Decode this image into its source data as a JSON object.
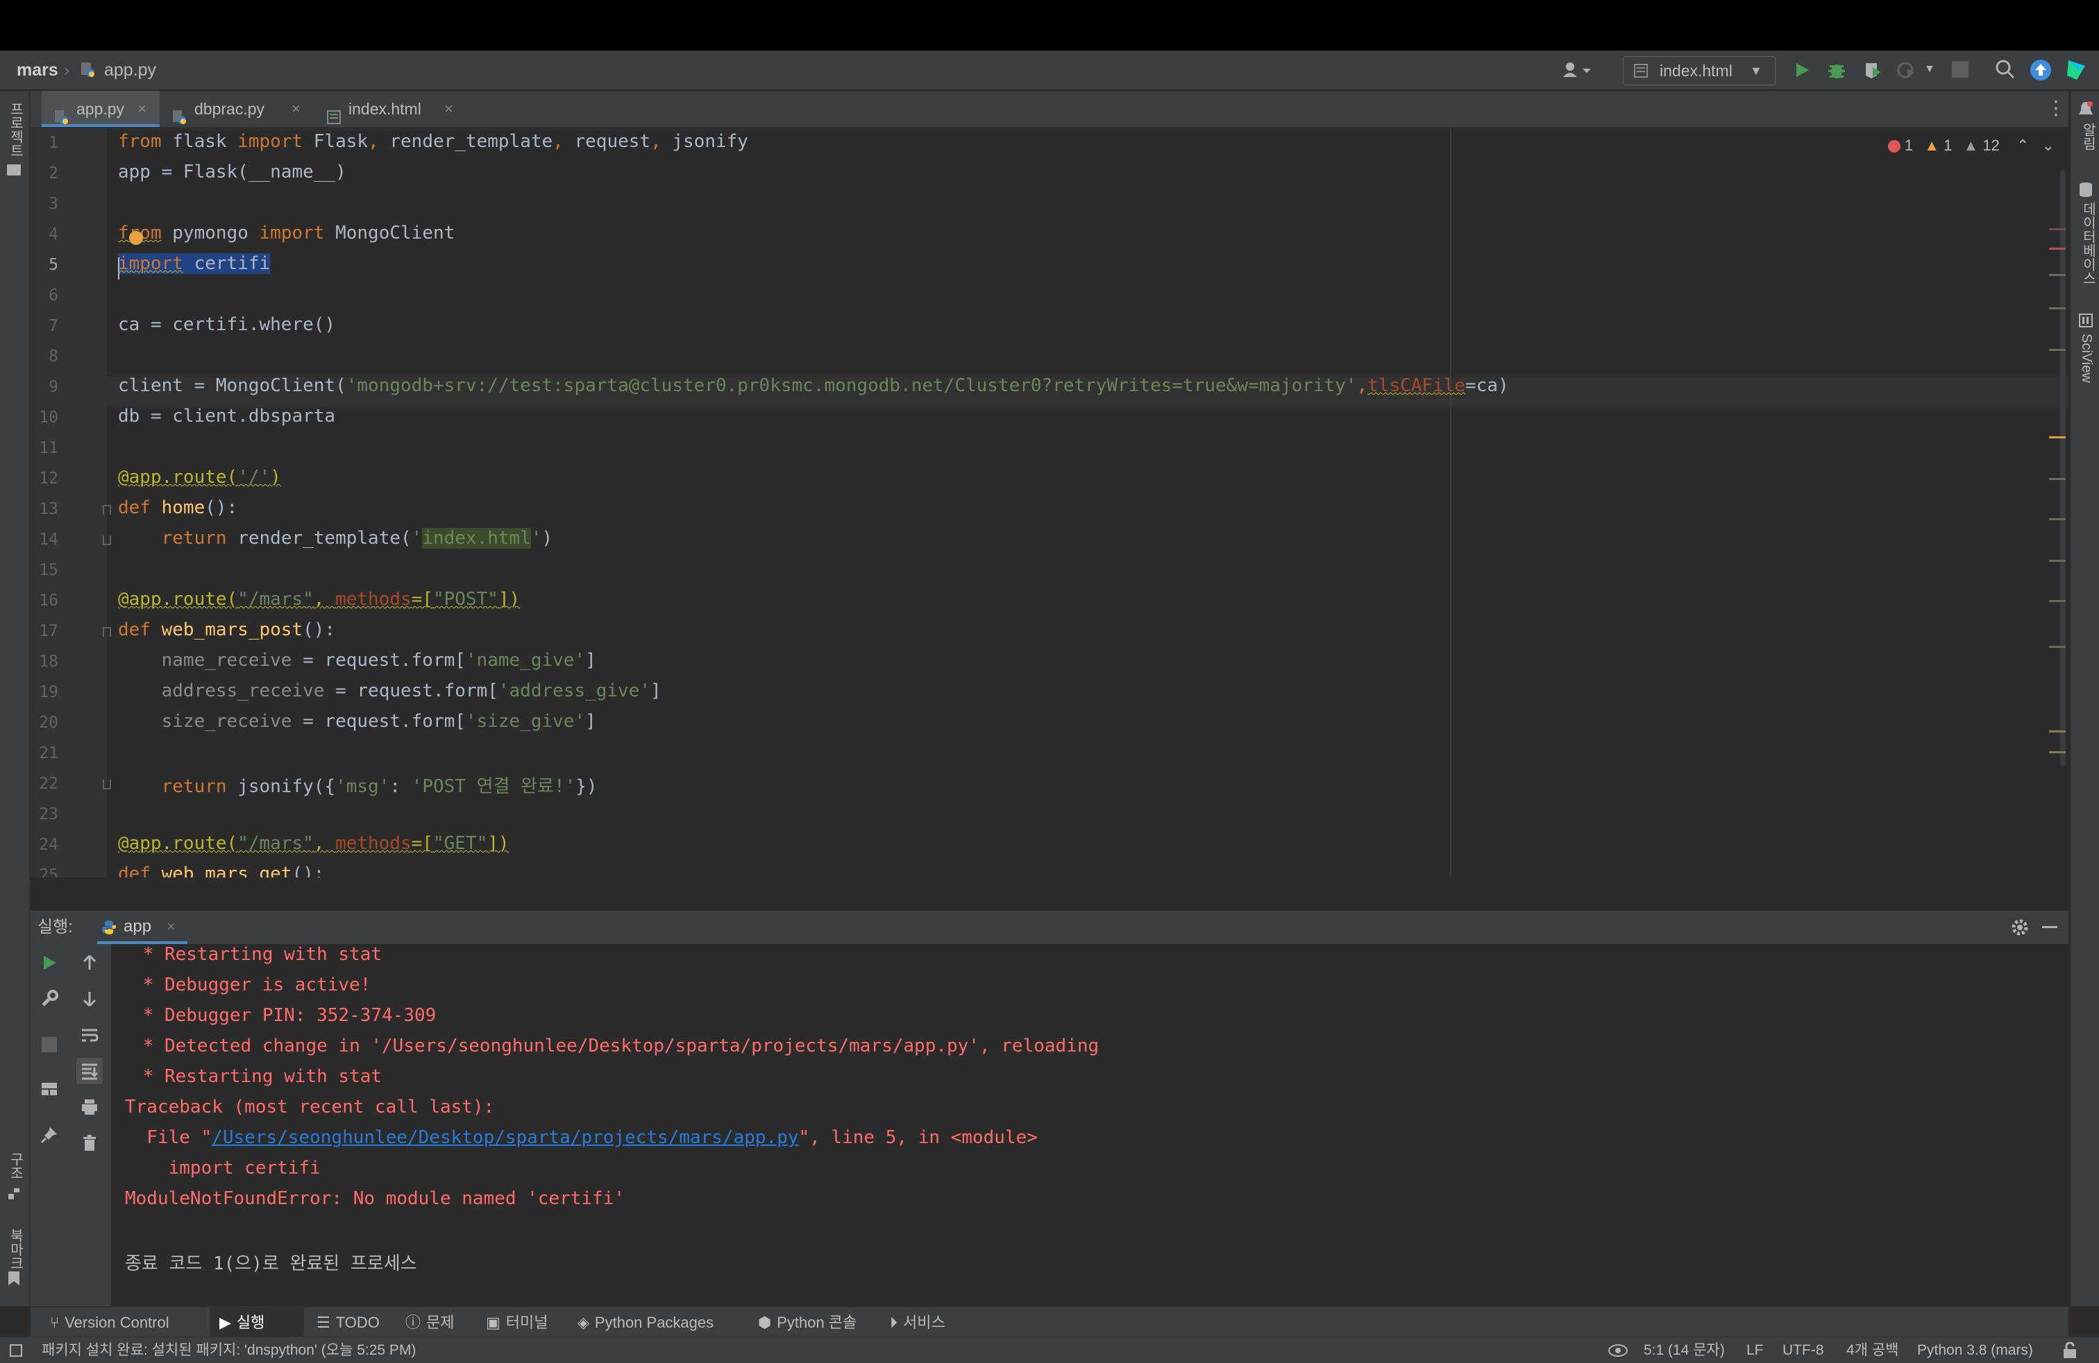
{
  "breadcrumb": {
    "project": "mars",
    "file": "app.py"
  },
  "toolbar": {
    "run_config": "index.html"
  },
  "tabs": [
    {
      "label": "app.py",
      "active": true
    },
    {
      "label": "dbprac.py",
      "active": false
    },
    {
      "label": "index.html",
      "active": false
    }
  ],
  "left_strip": {
    "project": "프로젝트",
    "structure": "구조",
    "bookmarks": "북마크"
  },
  "right_strip": {
    "notifications": "알림",
    "database": "데이터베이스",
    "sciview": "SciView"
  },
  "inspections": {
    "errors": "1",
    "warnings": "1",
    "weak_warnings": "12"
  },
  "editor": {
    "line_numbers": [
      "1",
      "2",
      "3",
      "4",
      "5",
      "6",
      "7",
      "8",
      "9",
      "10",
      "11",
      "12",
      "13",
      "14",
      "15",
      "16",
      "17",
      "18",
      "19",
      "20",
      "21",
      "22",
      "23",
      "24",
      "25"
    ],
    "current_line": 5,
    "lines": {
      "l1": {
        "a": "from",
        "b": " flask ",
        "c": "import",
        "d": " Flask",
        "e": ", ",
        "f": "render_template",
        "g": ", ",
        "h": "request",
        "i": ", ",
        "j": "jsonify"
      },
      "l2": "app = Flask(__name__)",
      "l4": {
        "a": "from",
        "b": " pymongo ",
        "c": "import",
        "d": " MongoClient"
      },
      "l5": {
        "a": "import",
        "b": " certifi"
      },
      "l7": "ca = certifi.where()",
      "l9": {
        "a": "client = MongoClient(",
        "b": "'mongodb+srv://test:sparta@cluster0.pr0ksmc.mongodb.net/Cluster0?retryWrites=true&w=majority'",
        "c": ",",
        "d": "tlsCAFile",
        "e": "=ca)"
      },
      "l10": "db = client.dbsparta",
      "l12": {
        "a": "@app.route(",
        "b": "'/'",
        "c": ")"
      },
      "l13": {
        "a": "def",
        "b": " home",
        "c": "():"
      },
      "l14": {
        "a": "    return",
        "b": " render_template(",
        "c": "'",
        "d": "index.html",
        "e": "'",
        "f": ")"
      },
      "l16": {
        "a": "@app.route(",
        "b": "\"/mars\"",
        "c": ", ",
        "d": "methods",
        "e": "=[",
        "f": "\"POST\"",
        "g": "])"
      },
      "l17": {
        "a": "def",
        "b": " web_mars_post",
        "c": "():"
      },
      "l18": {
        "a": "    name_receive",
        "b": " = request.form[",
        "c": "'name_give'",
        "d": "]"
      },
      "l19": {
        "a": "    address_receive",
        "b": " = request.form[",
        "c": "'address_give'",
        "d": "]"
      },
      "l20": {
        "a": "    size_receive",
        "b": " = request.form[",
        "c": "'size_give'",
        "d": "]"
      },
      "l22": {
        "a": "    return",
        "b": " jsonify({",
        "c": "'msg'",
        "d": ": ",
        "e": "'POST 연결 완료!'",
        "f": "})"
      },
      "l24": {
        "a": "@app.route(",
        "b": "\"/mars\"",
        "c": ", ",
        "d": "methods",
        "e": "=[",
        "f": "\"GET\"",
        "g": "])"
      },
      "l25": {
        "a": "def",
        "b": " web_mars_get",
        "c": "():"
      }
    }
  },
  "run_panel": {
    "label": "실행:",
    "tab": "app",
    "output": {
      "o1": " * Restarting with stat",
      "o2": " * Debugger is active!",
      "o3": " * Debugger PIN: 352-374-309",
      "o4": " * Detected change in '/Users/seonghunlee/Desktop/sparta/projects/mars/app.py', reloading",
      "o5": " * Restarting with stat",
      "o6": "Traceback (most recent call last):",
      "o7a": "  File \"",
      "o7b": "/Users/seonghunlee/Desktop/sparta/projects/mars/app.py",
      "o7c": "\", line 5, in <module>",
      "o8": "    import certifi",
      "o9": "ModuleNotFoundError: No module named 'certifi'",
      "o10": "종료 코드 1(으)로 완료된 프로세스"
    }
  },
  "tool_windows": [
    {
      "label": "Version Control",
      "icon": "branch-icon"
    },
    {
      "label": "실행",
      "icon": "play-icon",
      "active": true
    },
    {
      "label": "TODO",
      "icon": "list-icon"
    },
    {
      "label": "문제",
      "icon": "info-icon"
    },
    {
      "label": "터미널",
      "icon": "terminal-icon"
    },
    {
      "label": "Python Packages",
      "icon": "layers-icon"
    },
    {
      "label": "Python 콘솔",
      "icon": "python-icon"
    },
    {
      "label": "서비스",
      "icon": "services-icon"
    }
  ],
  "status": {
    "message": "패키지 설치 완료: 설치된 패키지: 'dnspython' (오늘 5:25 PM)",
    "position": "5:1 (14 문자)",
    "line_sep": "LF",
    "encoding": "UTF-8",
    "indent": "4개 공백",
    "interpreter": "Python 3.8 (mars)"
  },
  "colors": {
    "accent": "#4a88c7",
    "error": "#ff6b68",
    "run_green": "#499c54"
  }
}
